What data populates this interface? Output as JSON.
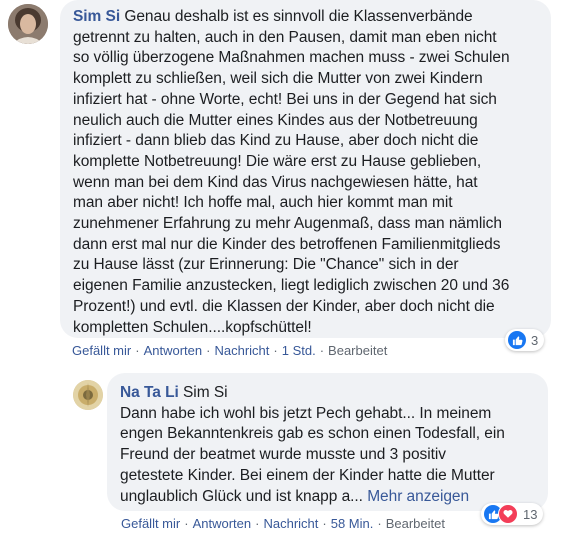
{
  "comment1": {
    "author": "Sim Si",
    "lines": [
      " Genau deshalb ist es sinnvoll die Klassenverbände",
      "getrennt zu halten, auch in den Pausen, damit man eben nicht",
      "so völlig überzogene Maßnahmen machen muss - zwei Schulen",
      "komplett zu schließen, weil sich die Mutter von zwei Kindern",
      "infiziert hat - ohne Worte, echt! Bei uns in der Gegend hat sich",
      "neulich auch die Mutter eines Kindes aus der Notbetreuung",
      "infiziert - dann blieb das Kind zu Hause, aber doch nicht die",
      "komplette Notbetreuung! Die wäre erst zu Hause geblieben,",
      "wenn man bei dem Kind das Virus nachgewiesen hätte, hat",
      "man aber nicht! Ich hoffe mal, auch hier kommt man mit",
      "zunehmener Erfahrung zu mehr Augenmaß, dass man nämlich",
      "dann erst mal nur die Kinder des betroffenen Familienmitglieds",
      "zu Hause lässt (zur Erinnerung: Die \"Chance\" sich in der",
      "eigenen Familie anzustecken, liegt lediglich zwischen 20 und 36",
      "Prozent!) und evtl. die Klassen der Kinder, aber doch nicht die",
      "kompletten Schulen....kopfschüttel!"
    ],
    "actions": {
      "like": "Gefällt mir",
      "reply": "Antworten",
      "message": "Nachricht",
      "time": "1 Std.",
      "edited": "Bearbeitet"
    },
    "reaction_count": "3"
  },
  "comment2": {
    "author": "Na Ta Li",
    "mention": "Sim Si",
    "lines": [
      "Dann habe ich wohl bis jetzt Pech gehabt... In meinem",
      "engen Bekanntenkreis gab es schon einen Todesfall, ein",
      "Freund der beatmet wurde musste und 3 positiv",
      "getestete Kinder. Bei einem der Kinder hatte die Mutter",
      "unglaublich Glück und ist knapp a..."
    ],
    "more_link": "Mehr anzeigen",
    "actions": {
      "like": "Gefällt mir",
      "reply": "Antworten",
      "message": "Nachricht",
      "time": "58 Min.",
      "edited": "Bearbeitet"
    },
    "reaction_count": "13"
  },
  "colors": {
    "link": "#385898",
    "bubble": "#f0f2f5",
    "like": "#1877f2",
    "love": "#f33e58"
  }
}
